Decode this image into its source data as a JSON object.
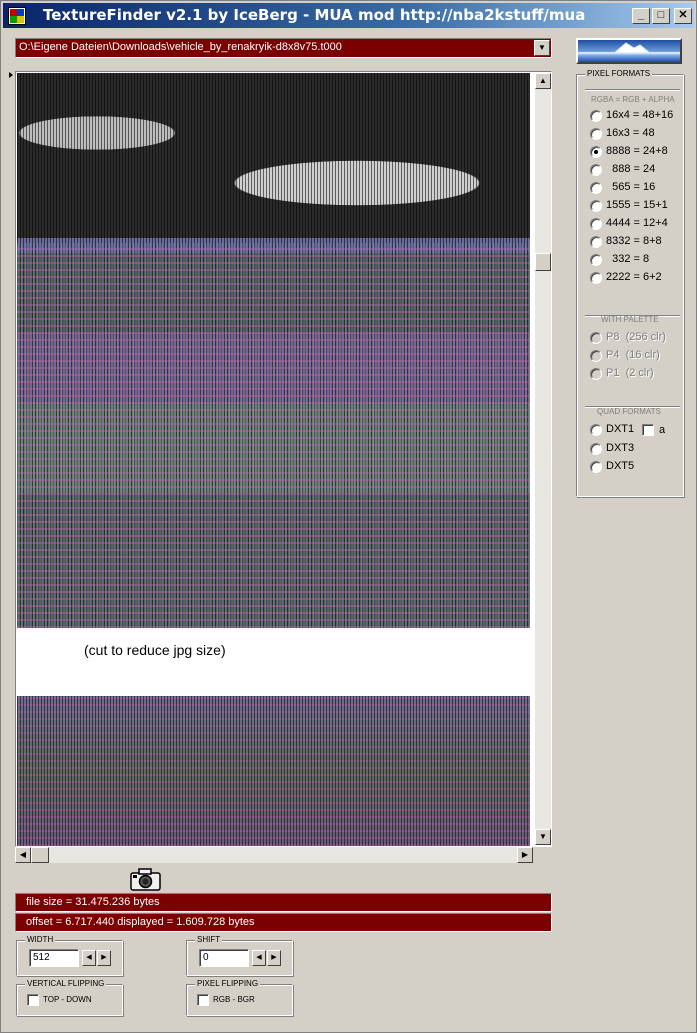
{
  "window": {
    "title": "TextureFinder v2.1 by IceBerg - MUA mod http://nba2kstuff/mua",
    "minimize_glyph": "_",
    "maximize_glyph": "□",
    "close_glyph": "✕"
  },
  "path": {
    "value": "O:\\Eigene Dateien\\Downloads\\vehicle_by_renakryik-d8x8v75.t000"
  },
  "viewer": {
    "note": "(cut to reduce jpg size)"
  },
  "status": {
    "file_size": "file size = 31.475.236 bytes",
    "offset": "offset = 6.717.440   displayed = 1.609.728 bytes"
  },
  "pixel_formats": {
    "title": "PIXEL FORMATS",
    "rgba_heading": "RGBA = RGB + ALPHA",
    "rgba_options": [
      {
        "label": "16x4 = 48+16",
        "selected": false
      },
      {
        "label": "16x3 = 48",
        "selected": false
      },
      {
        "label": "8888 = 24+8",
        "selected": true
      },
      {
        "label": "  888 = 24",
        "selected": false
      },
      {
        "label": "  565 = 16",
        "selected": false
      },
      {
        "label": "1555 = 15+1",
        "selected": false
      },
      {
        "label": "4444 = 12+4",
        "selected": false
      },
      {
        "label": "8332 = 8+8",
        "selected": false
      },
      {
        "label": "  332 = 8",
        "selected": false
      },
      {
        "label": "2222 = 6+2",
        "selected": false
      }
    ],
    "palette_heading": "WITH PALETTE",
    "palette_options": [
      {
        "label": "P8  (256 clr)",
        "selected": false
      },
      {
        "label": "P4  (16 clr)",
        "selected": false
      },
      {
        "label": "P1  (2 clr)",
        "selected": false
      }
    ],
    "quad_heading": "QUAD FORMATS",
    "quad_options": [
      {
        "label": "DXT1",
        "selected": false
      },
      {
        "label": "DXT3",
        "selected": false
      },
      {
        "label": "DXT5",
        "selected": false
      }
    ],
    "dxt1_alpha_label": "a"
  },
  "width": {
    "title": "WIDTH",
    "value": "512"
  },
  "shift": {
    "title": "SHIFT",
    "value": "0"
  },
  "vertical_flipping": {
    "title": "VERTICAL FLIPPING",
    "option_label": "TOP - DOWN"
  },
  "pixel_flipping": {
    "title": "PIXEL FLIPPING",
    "option_label": "RGB  -  BGR"
  },
  "icons": {
    "app": "texturefinder-app-icon",
    "camera": "camera-icon",
    "logo": "iceberg-logo"
  }
}
